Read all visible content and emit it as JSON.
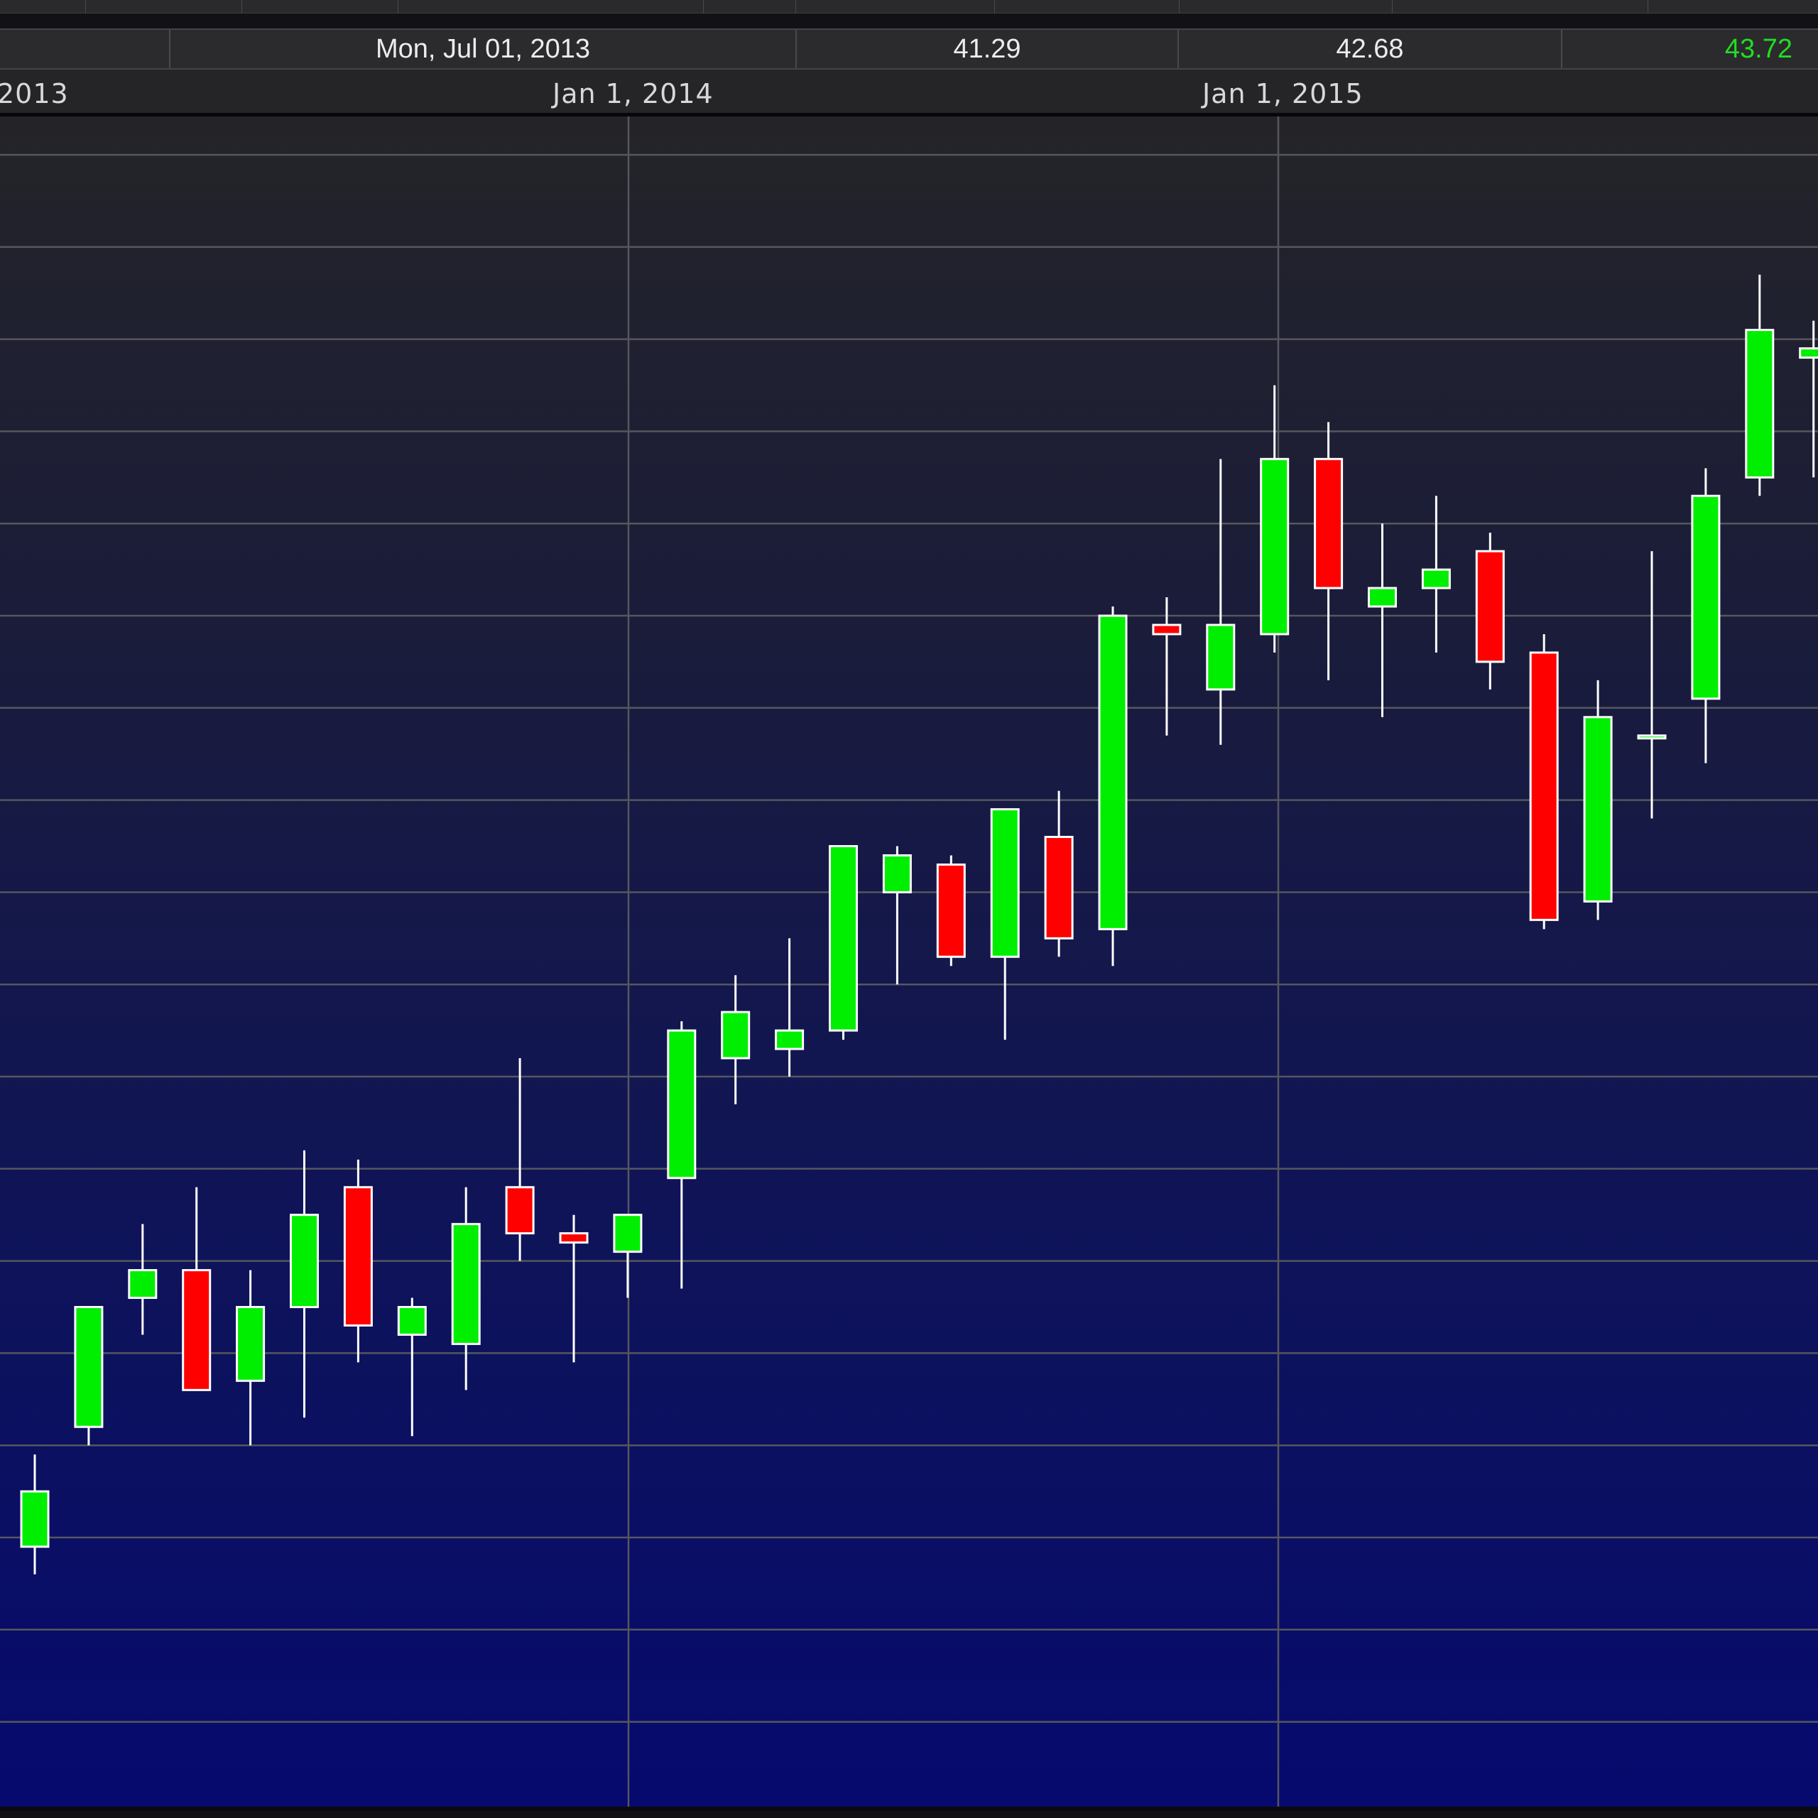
{
  "info_row": {
    "date": "Mon, Jul 01, 2013",
    "value_1": "41.29",
    "value_2": "42.68",
    "value_3": "43.72"
  },
  "colors": {
    "up": "#00ee00",
    "down": "#ff0000",
    "wick": "#ffffff",
    "grid": "#55575e",
    "highlight_value": "#22dd22"
  },
  "chart_data": {
    "type": "candlestick",
    "x_axis": {
      "tick_labels": [
        "2013",
        "Jan 1, 2014",
        "Jan 1, 2015"
      ]
    },
    "grid": true,
    "y_range": [
      0,
      36
    ],
    "series": [
      {
        "candles": [
          {
            "open": 2.9,
            "close": 3.5,
            "high": 3.9,
            "low": 2.6
          },
          {
            "open": 4.2,
            "close": 5.5,
            "high": 5.5,
            "low": 4.0
          },
          {
            "open": 5.6,
            "close": 5.9,
            "high": 6.4,
            "low": 5.2
          },
          {
            "open": 5.9,
            "close": 4.6,
            "high": 6.8,
            "low": 4.6
          },
          {
            "open": 4.7,
            "close": 5.5,
            "high": 5.9,
            "low": 4.0
          },
          {
            "open": 5.5,
            "close": 6.5,
            "high": 7.2,
            "low": 4.3
          },
          {
            "open": 6.8,
            "close": 5.3,
            "high": 7.1,
            "low": 4.9
          },
          {
            "open": 5.2,
            "close": 5.5,
            "high": 5.6,
            "low": 4.1
          },
          {
            "open": 5.1,
            "close": 6.4,
            "high": 6.8,
            "low": 4.6
          },
          {
            "open": 6.8,
            "close": 6.3,
            "high": 8.2,
            "low": 6.0
          },
          {
            "open": 6.3,
            "close": 6.2,
            "high": 6.5,
            "low": 4.9
          },
          {
            "open": 6.1,
            "close": 6.5,
            "high": 6.5,
            "low": 5.6
          },
          {
            "open": 6.9,
            "close": 8.5,
            "high": 8.6,
            "low": 5.7
          },
          {
            "open": 8.2,
            "close": 8.7,
            "high": 9.1,
            "low": 7.7
          },
          {
            "open": 8.3,
            "close": 8.5,
            "high": 9.5,
            "low": 8.0
          },
          {
            "open": 8.5,
            "close": 10.5,
            "high": 10.5,
            "low": 8.4
          },
          {
            "open": 10.0,
            "close": 10.4,
            "high": 10.5,
            "low": 9.0
          },
          {
            "open": 10.3,
            "close": 9.3,
            "high": 10.4,
            "low": 9.2
          },
          {
            "open": 9.3,
            "close": 10.9,
            "high": 10.9,
            "low": 8.4
          },
          {
            "open": 10.6,
            "close": 9.5,
            "high": 11.1,
            "low": 9.3
          },
          {
            "open": 9.6,
            "close": 13.0,
            "high": 13.1,
            "low": 9.2
          },
          {
            "open": 12.9,
            "close": 12.8,
            "high": 13.2,
            "low": 11.7
          },
          {
            "open": 12.2,
            "close": 12.9,
            "high": 14.7,
            "low": 11.6
          },
          {
            "open": 12.8,
            "close": 14.7,
            "high": 15.5,
            "low": 12.6
          },
          {
            "open": 14.7,
            "close": 13.3,
            "high": 15.1,
            "low": 12.3
          },
          {
            "open": 13.1,
            "close": 13.3,
            "high": 14.0,
            "low": 11.9
          },
          {
            "open": 13.3,
            "close": 13.5,
            "high": 14.3,
            "low": 12.6
          },
          {
            "open": 13.7,
            "close": 12.5,
            "high": 13.9,
            "low": 12.2
          },
          {
            "open": 12.6,
            "close": 9.7,
            "high": 12.8,
            "low": 9.6
          },
          {
            "open": 9.9,
            "close": 11.9,
            "high": 12.3,
            "low": 9.7
          },
          {
            "open": 11.7,
            "close": 11.7,
            "high": 13.7,
            "low": 10.8
          },
          {
            "open": 12.1,
            "close": 14.3,
            "high": 14.6,
            "low": 11.4
          },
          {
            "open": 14.5,
            "close": 16.1,
            "high": 16.7,
            "low": 14.3
          },
          {
            "open": 15.8,
            "close": 15.9,
            "high": 16.2,
            "low": 14.5
          }
        ]
      }
    ]
  }
}
